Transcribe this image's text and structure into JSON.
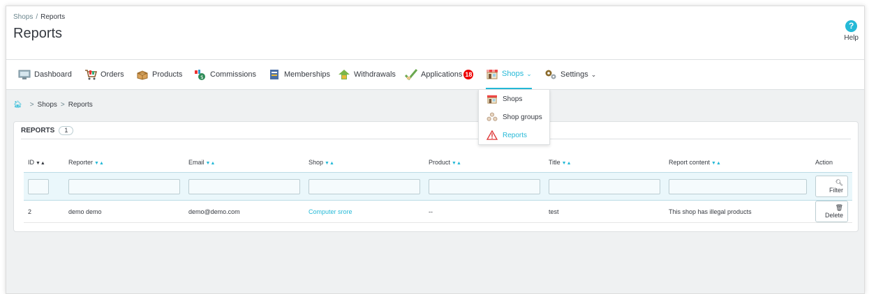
{
  "header": {
    "breadcrumb_parent": "Shops",
    "breadcrumb_sep": "/",
    "breadcrumb_current": "Reports",
    "title": "Reports",
    "help_label": "Help"
  },
  "menu": {
    "items": [
      {
        "label": "Dashboard",
        "icon": "dashboard-icon"
      },
      {
        "label": "Orders",
        "icon": "cart-icon"
      },
      {
        "label": "Products",
        "icon": "box-icon"
      },
      {
        "label": "Commissions",
        "icon": "money-bag-icon"
      },
      {
        "label": "Memberships",
        "icon": "membership-icon"
      },
      {
        "label": "Withdrawals",
        "icon": "withdrawal-icon"
      },
      {
        "label": "Applications",
        "icon": "check-icon",
        "badge": "18"
      },
      {
        "label": "Shops",
        "icon": "shop-icon",
        "active": true
      },
      {
        "label": "Settings",
        "icon": "gear-icon"
      }
    ]
  },
  "dropdown": {
    "items": [
      {
        "label": "Shops",
        "icon": "shop-icon"
      },
      {
        "label": "Shop groups",
        "icon": "group-icon"
      },
      {
        "label": "Reports",
        "icon": "warning-icon",
        "active": true
      }
    ]
  },
  "subcrumb": {
    "items": [
      "Shops",
      "Reports"
    ],
    "separator": ">"
  },
  "panel": {
    "title": "REPORTS",
    "count": "1",
    "columns": [
      "ID",
      "Reporter",
      "Email",
      "Shop",
      "Product",
      "Title",
      "Report content",
      "Action"
    ],
    "filter_button": "Filter",
    "rows": [
      {
        "id": "2",
        "reporter": "demo demo",
        "email": "demo@demo.com",
        "shop": "Computer srore",
        "product": "--",
        "title": "test",
        "content": "This shop has illegal products",
        "action": "Delete"
      }
    ]
  },
  "colors": {
    "accent": "#25b9d7",
    "badge": "#e00000",
    "text": "#363a41"
  }
}
